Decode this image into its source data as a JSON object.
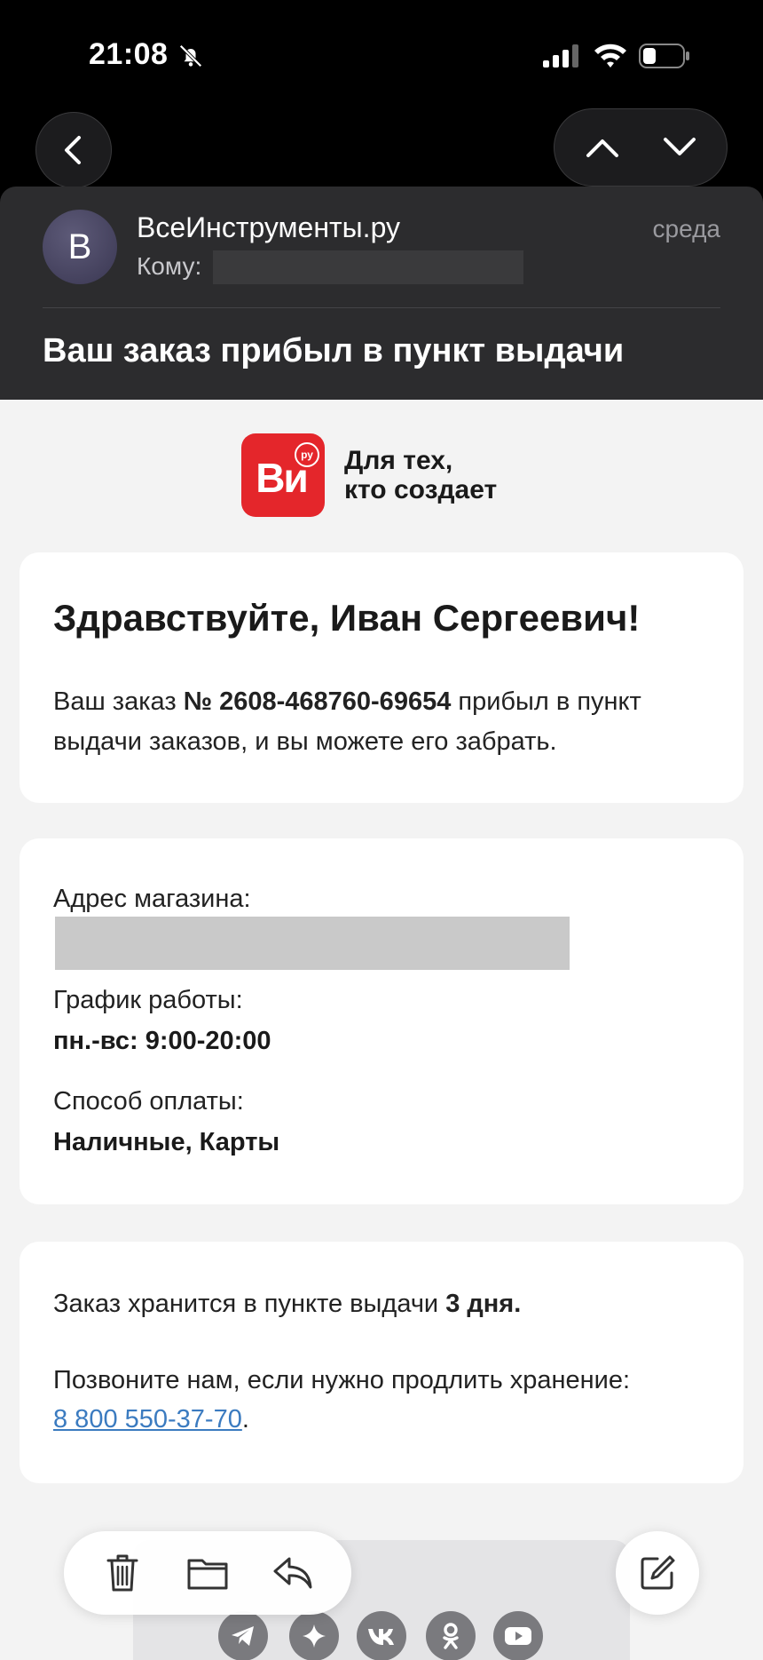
{
  "status_bar": {
    "time": "21:08"
  },
  "email": {
    "sender_initial": "В",
    "sender": "ВсеИнструменты.ру",
    "date": "среда",
    "to_label": "Кому:",
    "subject": "Ваш заказ прибыл в пункт выдачи"
  },
  "logo": {
    "mark": "Ви",
    "badge": "ру",
    "tagline_line1": "Для тех,",
    "tagline_line2": "кто создает"
  },
  "greeting_card": {
    "greeting": "Здравствуйте, Иван Сергеевич!",
    "text_before": "Ваш заказ ",
    "order_number": "№ 2608-468760-69654",
    "text_after": " прибыл в пункт выдачи заказов, и вы можете его забрать."
  },
  "store_card": {
    "address_label": "Адрес магазина:",
    "hours_label": "График работы:",
    "hours_value": "пн.-вс: 9:00-20:00",
    "payment_label": "Способ оплаты:",
    "payment_value": "Наличные, Карты"
  },
  "storage_card": {
    "storage_text": "Заказ хранится в пункте выдачи ",
    "storage_days": "3 дня.",
    "call_text": "Позвоните нам, если нужно продлить хранение:",
    "phone": "8 800 550-37-70",
    "phone_suffix": "."
  },
  "toolbar": {
    "icons": [
      "trash-icon",
      "folder-icon",
      "reply-icon"
    ],
    "compose_icon": "compose-icon"
  },
  "social_icons": [
    "telegram-icon",
    "sparkle-icon",
    "vk-icon",
    "ok-icon",
    "youtube-icon"
  ]
}
